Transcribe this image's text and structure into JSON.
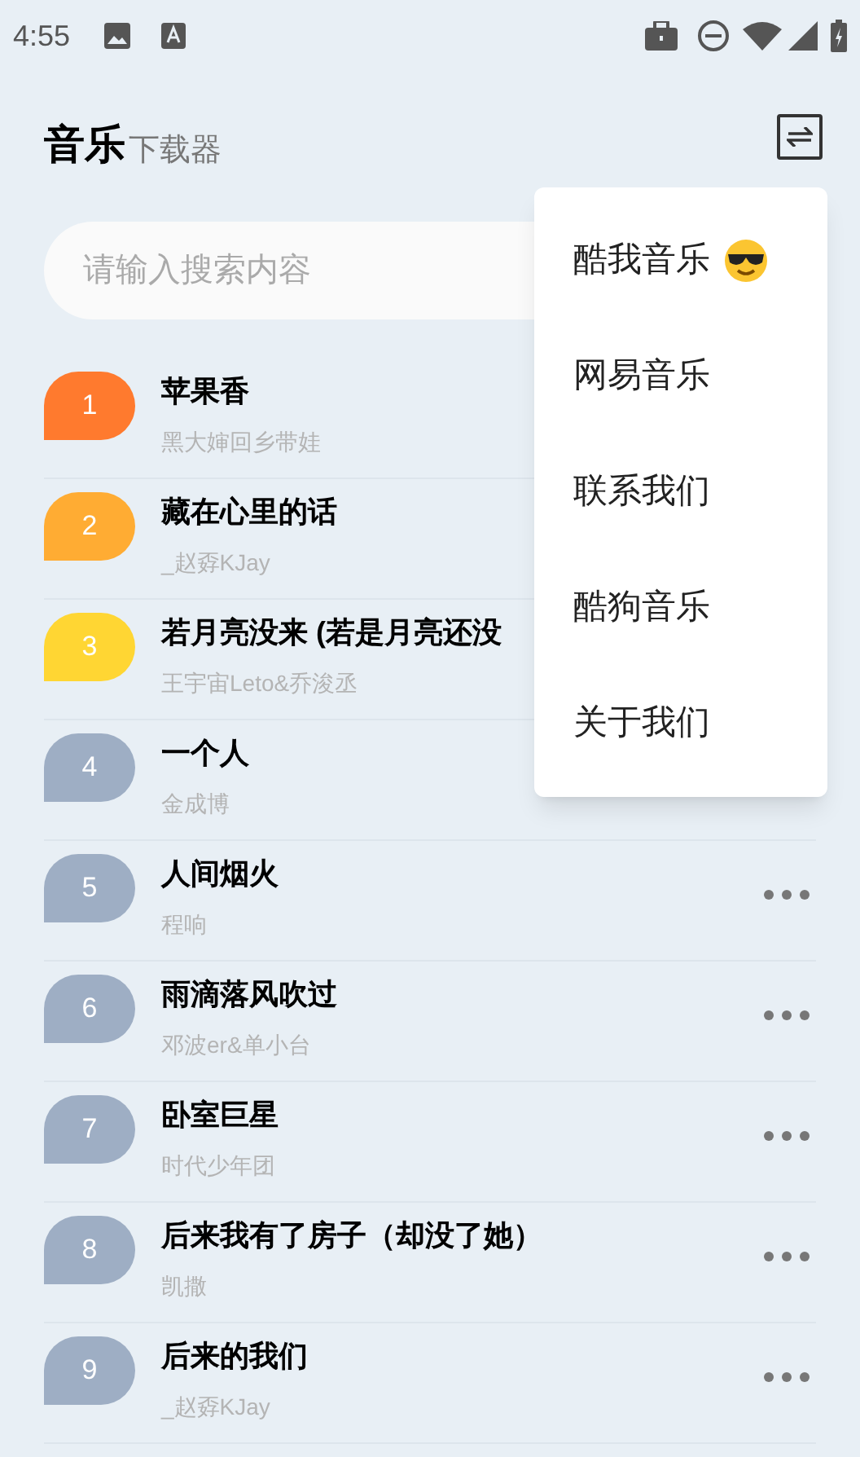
{
  "status_bar": {
    "time": "4:55"
  },
  "header": {
    "title": "音乐",
    "subtitle": "下载器"
  },
  "search": {
    "placeholder": "请输入搜索内容"
  },
  "songs": [
    {
      "rank": "1",
      "title": "苹果香",
      "artist": "黑大婶回乡带娃",
      "color": "#ff7a2e",
      "more": false
    },
    {
      "rank": "2",
      "title": "藏在心里的话",
      "artist": "_赵孬KJay",
      "color": "#ffac33",
      "more": false
    },
    {
      "rank": "3",
      "title": "若月亮没来 (若是月亮还没",
      "artist": "王宇宙Leto&乔浚丞",
      "color": "#ffd633",
      "more": false
    },
    {
      "rank": "4",
      "title": "一个人",
      "artist": "金成博",
      "color": "#9eaec4",
      "more": false
    },
    {
      "rank": "5",
      "title": "人间烟火",
      "artist": "程响",
      "color": "#9eaec4",
      "more": true
    },
    {
      "rank": "6",
      "title": "雨滴落风吹过",
      "artist": "邓波er&单小台",
      "color": "#9eaec4",
      "more": true
    },
    {
      "rank": "7",
      "title": "卧室巨星",
      "artist": "时代少年团",
      "color": "#9eaec4",
      "more": true
    },
    {
      "rank": "8",
      "title": "后来我有了房子（却没了她）",
      "artist": "凯撒",
      "color": "#9eaec4",
      "more": true
    },
    {
      "rank": "9",
      "title": "后来的我们",
      "artist": "_赵孬KJay",
      "color": "#9eaec4",
      "more": true
    }
  ],
  "menu": [
    {
      "label": "酷我音乐",
      "kind": "emoji"
    },
    {
      "label": "网易音乐",
      "kind": "plain"
    },
    {
      "label": "联系我们",
      "kind": "plain"
    },
    {
      "label": "酷狗音乐",
      "kind": "plain"
    },
    {
      "label": "关于我们",
      "kind": "plain"
    }
  ]
}
